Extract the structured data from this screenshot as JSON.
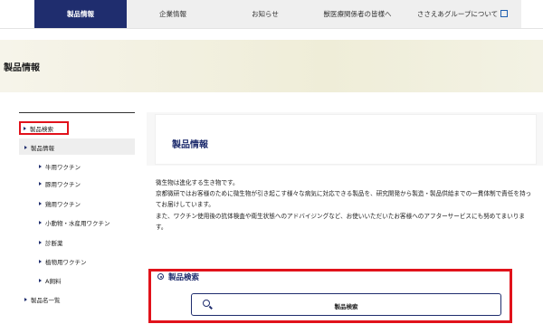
{
  "nav": {
    "tabs": [
      {
        "label": "製品情報"
      },
      {
        "label": "企業情報"
      },
      {
        "label": "お知らせ"
      },
      {
        "label": "獣医療関係者の皆様へ"
      },
      {
        "label": "ささえあグループについて"
      }
    ]
  },
  "banner": {
    "title": "製品情報"
  },
  "sidebar": {
    "search": "製品検索",
    "product_info": "製品情報",
    "subitems": [
      "牛用ワクチン",
      "豚用ワクチン",
      "鶏用ワクチン",
      "小動物・水産用ワクチン",
      "診断薬",
      "植物用ワクチン",
      "A飼料"
    ],
    "product_list": "製品名一覧"
  },
  "main": {
    "heading": "製品情報",
    "paragraphs": [
      "微生物は進化する生き物です。",
      "京都微研ではお客様のために微生物が引き起こす様々な病気に対応できる製品を、研究開発から製造・製品供給までの一貫体制で責任を持ってお届けしています。",
      "また、ワクチン使用後の抗体検査や衛生状態へのアドバイジングなど、お使いいただいたお客様へのアフターサービスにも努めてまいります。"
    ],
    "search_title": "製品検索",
    "search_button": "製品検索"
  },
  "colors": {
    "accent": "#1f2d6e",
    "highlight": "#e1121b"
  }
}
